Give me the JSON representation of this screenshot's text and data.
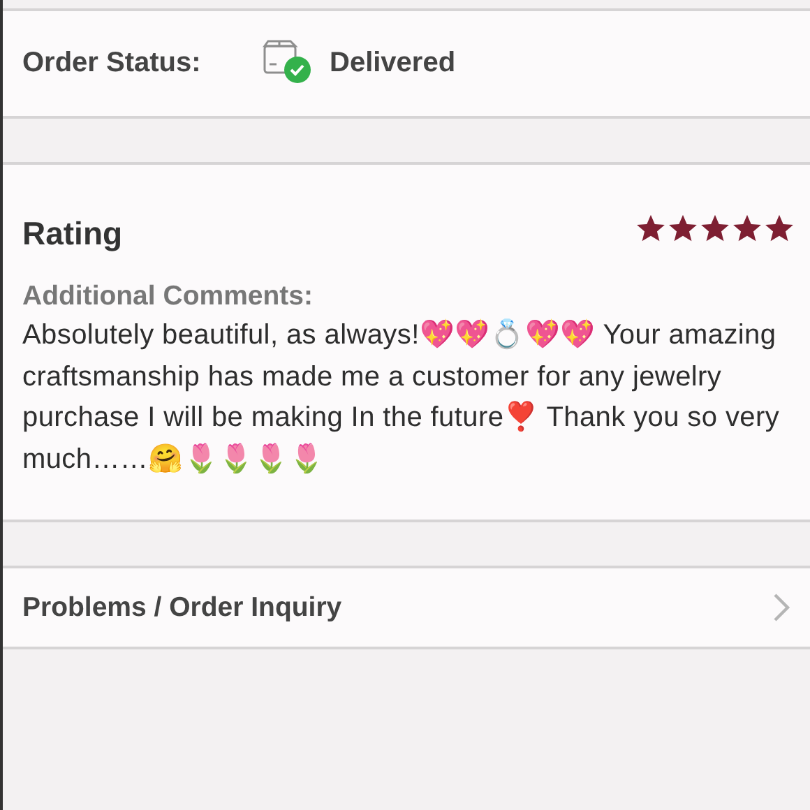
{
  "order_status": {
    "label": "Order Status:",
    "value": "Delivered"
  },
  "rating": {
    "title": "Rating",
    "stars": 5,
    "comments_label": "Additional Comments:",
    "comment": "Absolutely beautiful, as always!💖💖💍💖💖 Your amazing craftsmanship has made me a customer for any jewelry purchase I will be making In the future❣️ Thank you so very much……🤗🌷🌷🌷🌷"
  },
  "problems": {
    "label": "Problems / Order Inquiry"
  }
}
